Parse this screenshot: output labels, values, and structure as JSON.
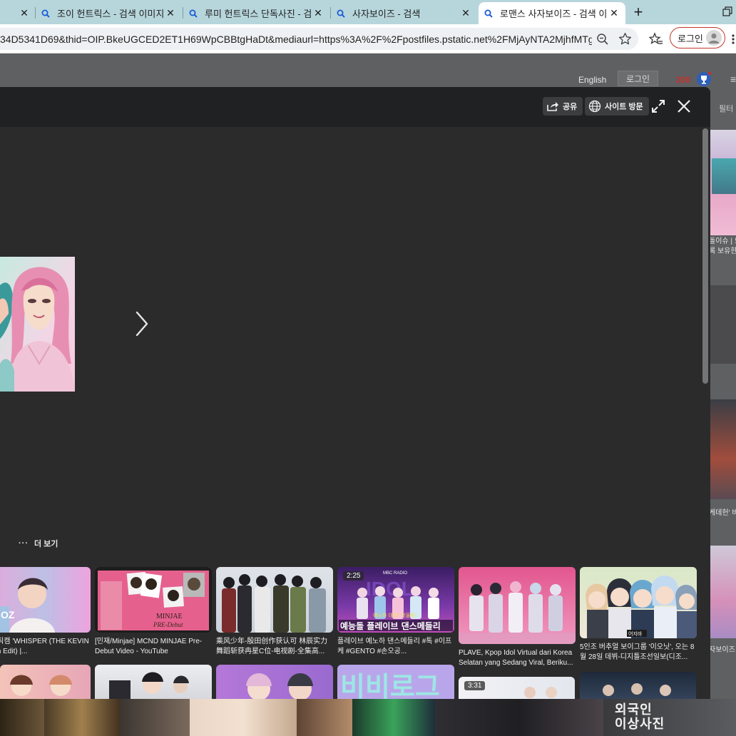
{
  "browser": {
    "tabs": [
      {
        "title": "조이 헌트릭스 - 검색 이미지",
        "active": false
      },
      {
        "title": "루미 헌트릭스 단독사진 - 검",
        "active": false
      },
      {
        "title": "사자보이즈 - 검색",
        "active": false
      },
      {
        "title": "로맨스 사자보이즈 - 검색 이",
        "active": true
      }
    ],
    "new_tab": "+",
    "close_symbol": "✕",
    "url": "34D5341D69&thid=OIP.BkeUGCED2ET1H69WpCBBtgHaDt&mediaurl=https%3A%2F%2Fpostfiles.pstatic.net%2FMjAyNTA2MjhfMTg0...",
    "login_label": "로그인"
  },
  "bing": {
    "english": "English",
    "login": "로그인",
    "points": "200",
    "filter": "필터",
    "side_text_1": "돌이슈 | 드",
    "side_text_1b": "록 보유한",
    "side_text_2": "케데헌' 비",
    "side_text_3": "자보이즈",
    "bottom_text_1": "외국인",
    "bottom_text_2": "이상사진"
  },
  "viewer": {
    "share_label": "공유",
    "visit_label": "사이트 방문",
    "more_label": "더 보기",
    "more_dots": "···"
  },
  "related": [
    {
      "caption": "즈 케빈 직캠 'WHISPER (THE KEVIN FanCam Edit) |...",
      "badge": ""
    },
    {
      "caption": "[민재/Minjae] MCND MINJAE Pre-Debut Video - YouTube",
      "badge": ""
    },
    {
      "caption": "乘风少年-殷田创作获认可 林辰实力舞蹈斩获冉星C位-电视剧-全集高...",
      "badge": ""
    },
    {
      "caption": "플레이브 예노하 댄스메들리 #톡 #이프케 #GENTO #손오공...",
      "badge": "2:25"
    },
    {
      "caption": "PLAVE, Kpop Idol Virtual dari Korea Selatan yang Sedang Viral, Beriku...",
      "badge": ""
    },
    {
      "caption": "5인조 버추얼 보이그룹 '이오닛', 오는 8월 28일 데뷔-디지틀조선일보(디조...",
      "badge": ""
    }
  ],
  "second_row": {
    "badge": "3:31",
    "thumb4_text": "비비로그"
  },
  "thumb_texts": {
    "minjae_card": "MINJAE",
    "minjae_sub": "PRE-Debut",
    "plave_banner": "예능돌 플레이브 댄스메들리",
    "plave_small": "예노하 대전! 어울림!",
    "mbc_radio": "MBC RADIO",
    "idol_word": "IDOL",
    "oz_text": "OZ",
    "tag_text": "어지바"
  },
  "colors": {
    "tabbar": "#b7d6dc",
    "viewer_bg": "#2b2b2c",
    "header_bg": "#202122",
    "accent_red": "#c0392b"
  }
}
